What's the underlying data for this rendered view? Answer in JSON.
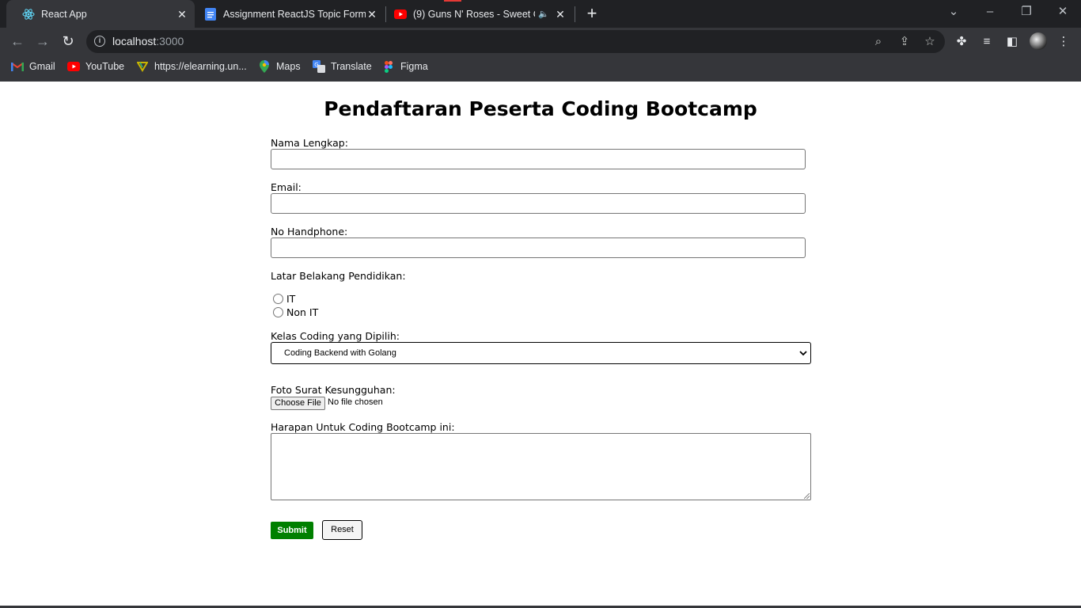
{
  "browser": {
    "tabs": [
      {
        "title": "React App",
        "icon": "react-icon"
      },
      {
        "title": "Assignment ReactJS Topic Form -",
        "icon": "google-docs-icon"
      },
      {
        "title": "(9) Guns N' Roses - Sweet Ch",
        "icon": "youtube-icon"
      }
    ],
    "url_host": "localhost",
    "url_port": ":3000",
    "bookmarks": [
      {
        "label": "Gmail",
        "icon": "gmail-icon"
      },
      {
        "label": "YouTube",
        "icon": "youtube-icon"
      },
      {
        "label": "https://elearning.un...",
        "icon": "elearning-icon"
      },
      {
        "label": "Maps",
        "icon": "maps-icon"
      },
      {
        "label": "Translate",
        "icon": "translate-icon"
      },
      {
        "label": "Figma",
        "icon": "figma-icon"
      }
    ]
  },
  "form": {
    "title": "Pendaftaran Peserta Coding Bootcamp",
    "nama_label": "Nama Lengkap:",
    "email_label": "Email:",
    "phone_label": "No Handphone:",
    "pendidikan_label": "Latar Belakang Pendidikan:",
    "radio_options": [
      "IT",
      "Non IT"
    ],
    "kelas_label": "Kelas Coding yang Dipilih:",
    "kelas_selected": "Coding Backend with Golang",
    "foto_label": "Foto Surat Kesungguhan:",
    "file_button": "Choose File",
    "file_status": "No file chosen",
    "harapan_label": "Harapan Untuk Coding Bootcamp ini:",
    "submit_label": "Submit",
    "reset_label": "Reset"
  },
  "colors": {
    "submit_bg": "#008000",
    "chrome_bg": "#35363a",
    "tabstrip_bg": "#202124"
  }
}
